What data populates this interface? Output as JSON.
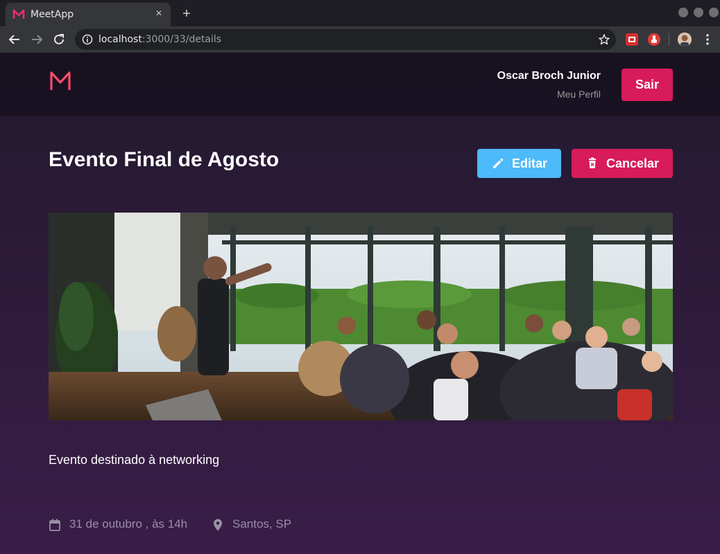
{
  "browser": {
    "tab_title": "MeetApp",
    "tab_close": "×",
    "new_tab": "+",
    "url_host": "localhost",
    "url_path": ":3000/33/details"
  },
  "header": {
    "logo_icon": "meetapp-logo-icon",
    "user_name": "Oscar Broch Junior",
    "profile_link": "Meu Perfil",
    "logout_label": "Sair"
  },
  "meetup": {
    "title": "Evento Final de Agosto",
    "edit_label": "Editar",
    "cancel_label": "Cancelar",
    "banner_alt": "photo-people-at-meetup",
    "description": "Evento destinado à networking",
    "date": "31 de outubro , às 14h",
    "location": "Santos, SP"
  },
  "colors": {
    "accent": "#d81b5a",
    "edit": "#4dbaf9",
    "muted_text": "#9a8fa8"
  }
}
